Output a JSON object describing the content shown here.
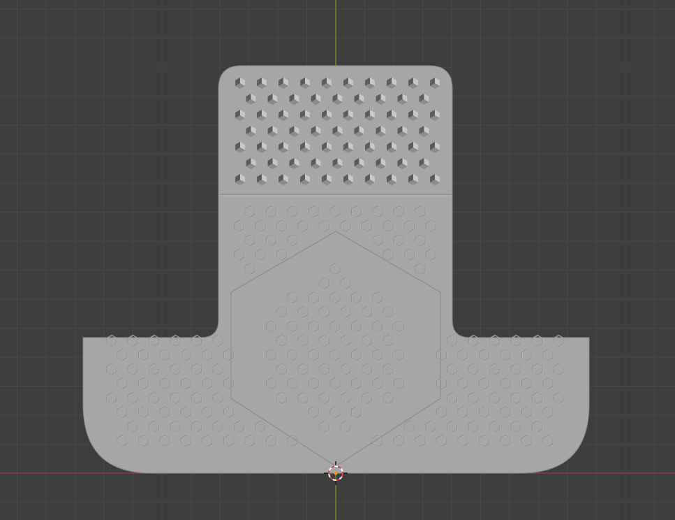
{
  "viewport": {
    "background": "#3d3d3d",
    "grid_minor_color": "#474747",
    "grid_major_color": "#525252",
    "x_axis_color": "#9a3b45",
    "y_axis_color": "#6f9b2a",
    "view": "top-orthographic"
  },
  "object": {
    "body_color": "#a6a6a6",
    "edge_color": "#8a8a8a",
    "emboss_color": "#8f8f8f",
    "emboss_highlight": "#b4b4b4",
    "hole_dark": "#5c5c5c",
    "hole_mid": "#8b8b8b",
    "hole_light": "#c9c9c9"
  },
  "cursor": {
    "icon": "3d-cursor-icon",
    "ring_color_a": "#e04040",
    "ring_color_b": "#ffffff",
    "center_color": "#f0a020"
  }
}
